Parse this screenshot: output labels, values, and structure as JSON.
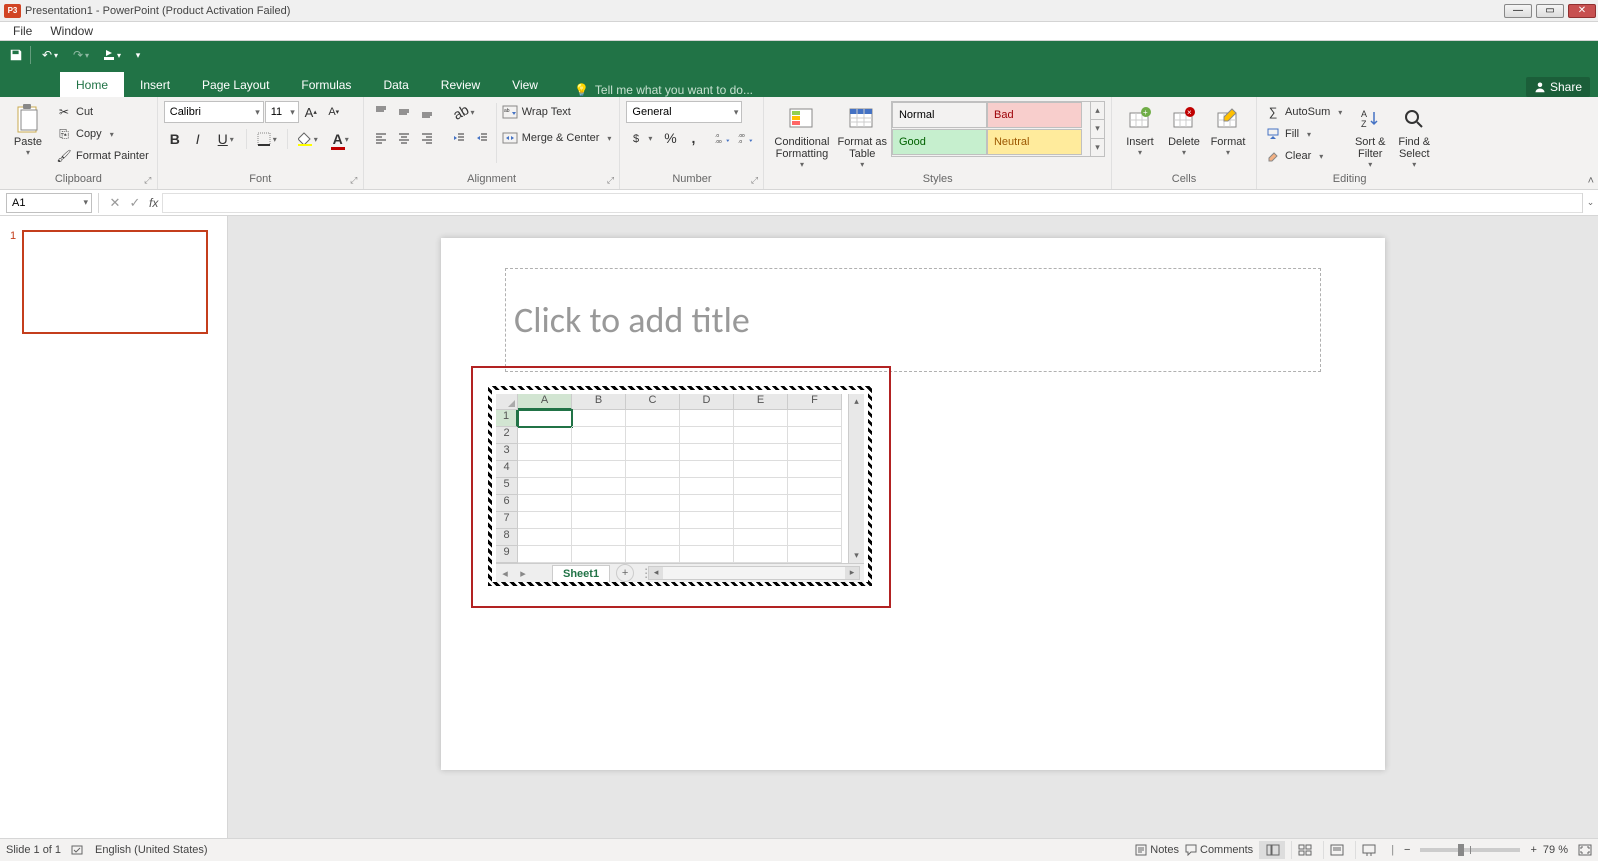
{
  "titlebar": {
    "app_badge": "P3",
    "title": "Presentation1 - PowerPoint (Product Activation Failed)"
  },
  "menubar": {
    "file": "File",
    "window": "Window"
  },
  "ribbon": {
    "tabs": [
      "Home",
      "Insert",
      "Page Layout",
      "Formulas",
      "Data",
      "Review",
      "View"
    ],
    "tell_me": "Tell me what you want to do...",
    "share": "Share"
  },
  "clipboard": {
    "paste": "Paste",
    "cut": "Cut",
    "copy": "Copy",
    "format_painter": "Format Painter",
    "label": "Clipboard"
  },
  "font": {
    "name": "Calibri",
    "size": "11",
    "label": "Font"
  },
  "alignment": {
    "wrap": "Wrap Text",
    "merge": "Merge & Center",
    "label": "Alignment"
  },
  "number": {
    "format": "General",
    "label": "Number"
  },
  "styles": {
    "cond": "Conditional\nFormatting",
    "fat": "Format as\nTable",
    "cells": [
      "Normal",
      "Bad",
      "Good",
      "Neutral"
    ],
    "colors": [
      "#ffffff",
      "#f8cecc",
      "#c6efce",
      "#ffeb9c"
    ],
    "fg": [
      "#333",
      "#9c0006",
      "#006100",
      "#9c5700"
    ],
    "label": "Styles"
  },
  "cells_grp": {
    "insert": "Insert",
    "delete": "Delete",
    "format": "Format",
    "label": "Cells"
  },
  "editing": {
    "autosum": "AutoSum",
    "fill": "Fill",
    "clear": "Clear",
    "sort": "Sort &\nFilter",
    "find": "Find &\nSelect",
    "label": "Editing"
  },
  "formula_bar": {
    "cell_ref": "A1"
  },
  "slide": {
    "thumb_num": "1",
    "title_placeholder": "Click to add title"
  },
  "excel": {
    "cols": [
      "A",
      "B",
      "C",
      "D",
      "E",
      "F"
    ],
    "rows": [
      "1",
      "2",
      "3",
      "4",
      "5",
      "6",
      "7",
      "8",
      "9"
    ],
    "sheet": "Sheet1"
  },
  "status": {
    "slide": "Slide 1 of 1",
    "lang": "English (United States)",
    "notes": "Notes",
    "comments": "Comments",
    "zoom": "79 %"
  }
}
